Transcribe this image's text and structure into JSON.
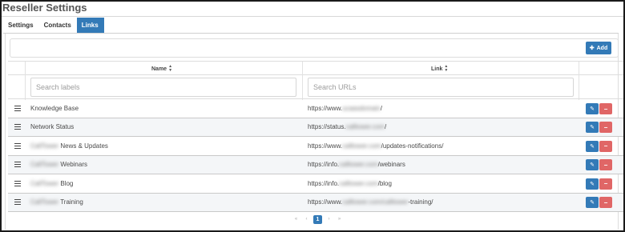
{
  "page": {
    "title": "Reseller Settings"
  },
  "tabs": [
    {
      "label": "Settings",
      "active": false
    },
    {
      "label": "Contacts",
      "active": false
    },
    {
      "label": "Links",
      "active": true
    }
  ],
  "toolbar": {
    "add_label": "Add",
    "add_icon": "plus-icon"
  },
  "table": {
    "columns": [
      {
        "label": "Name",
        "sortable": true
      },
      {
        "label": "Link",
        "sortable": true
      }
    ],
    "filters": {
      "labels_placeholder": "Search labels",
      "urls_placeholder": "Search URLs"
    },
    "rows": [
      {
        "label_pre": "",
        "label_redacted": "",
        "label_post": "Knowledge Base",
        "link_pre": "https://www.",
        "link_redacted": "ucaasdomain",
        "link_post": "/"
      },
      {
        "label_pre": "",
        "label_redacted": "",
        "label_post": "Network Status",
        "link_pre": "https://status.",
        "link_redacted": "calltower.com",
        "link_post": "/"
      },
      {
        "label_pre": "",
        "label_redacted": "CallTower",
        "label_post": " News & Updates",
        "link_pre": "https://www.",
        "link_redacted": "calltower.com",
        "link_post": "/updates-notifications/"
      },
      {
        "label_pre": "",
        "label_redacted": "CallTower",
        "label_post": " Webinars",
        "link_pre": "https://info.",
        "link_redacted": "calltower.com",
        "link_post": "/webinars"
      },
      {
        "label_pre": "",
        "label_redacted": "CallTower",
        "label_post": " Blog",
        "link_pre": "https://info.",
        "link_redacted": "calltower.com",
        "link_post": "/blog"
      },
      {
        "label_pre": "",
        "label_redacted": "CallTower",
        "label_post": " Training",
        "link_pre": "https://www.",
        "link_redacted": "calltower.com/calltower",
        "link_post": "-training/"
      }
    ],
    "actions": {
      "edit_icon": "pencil-icon",
      "delete_icon": "minus-icon"
    }
  },
  "pagination": {
    "first": "«",
    "prev": "‹",
    "current": "1",
    "next": "›",
    "last": "»"
  },
  "colors": {
    "primary": "#337ab7",
    "danger": "#e06666",
    "row_alt": "#f4f6f8"
  }
}
